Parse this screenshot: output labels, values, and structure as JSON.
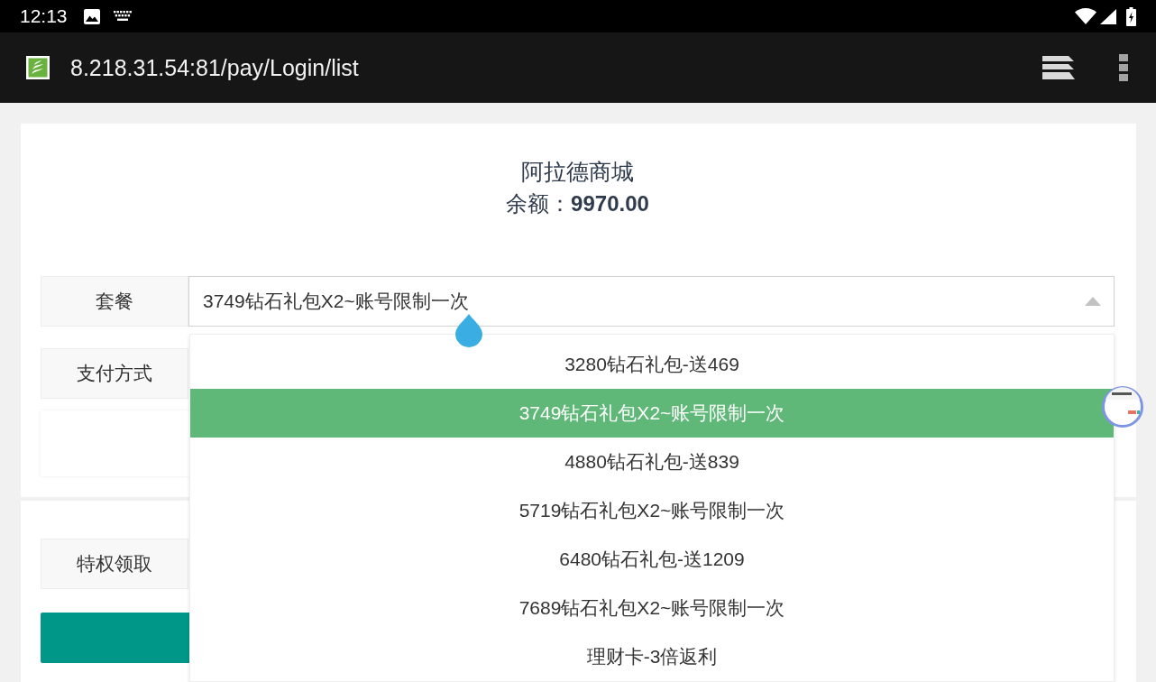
{
  "status_bar": {
    "time": "12:13"
  },
  "browser_toolbar": {
    "url": "8.218.31.54:81/pay/Login/list"
  },
  "shop": {
    "title": "阿拉德商城",
    "balance": "余额：**9970.00**"
  },
  "order_form": {
    "rows": [
      {
        "kind": "select",
        "label": "套餐",
        "value": "3749钻石礼包X2~账号限制一次",
        "expanded": true,
        "options": [
          {
            "label": "3280钻石礼包-送469",
            "selected": false
          },
          {
            "label": "3749钻石礼包X2~账号限制一次",
            "selected": true
          },
          {
            "label": "4880钻石礼包-送839",
            "selected": false
          },
          {
            "label": "5719钻石礼包X2~账号限制一次",
            "selected": false
          },
          {
            "label": "6480钻石礼包-送1209",
            "selected": false
          },
          {
            "label": "7689钻石礼包X2~账号限制一次",
            "selected": false
          },
          {
            "label": "理财卡-3倍返利",
            "selected": false
          }
        ]
      },
      {
        "kind": "label",
        "label": "支付方式"
      }
    ]
  },
  "privilege_form": {
    "rows": [
      {
        "kind": "label",
        "label": "特权领取"
      }
    ]
  }
}
